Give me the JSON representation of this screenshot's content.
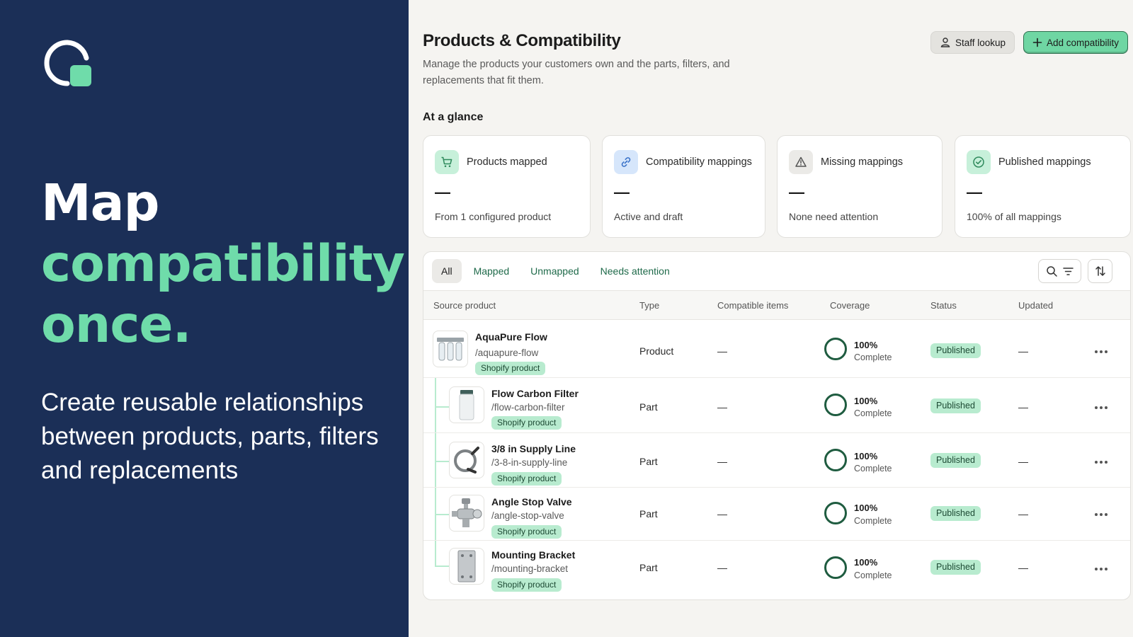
{
  "hero": {
    "headline_line1": "Map",
    "headline_line2": "compatibility",
    "headline_line3": "once.",
    "subline": "Create reusable relationships between products, parts, filters and replacements",
    "colors": {
      "background": "#1b2f57",
      "accent": "#6fdcaa"
    }
  },
  "header": {
    "title": "Products & Compatibility",
    "description": "Manage the products your customers own and the parts, filters, and replacements that fit them.",
    "staff_lookup_label": "Staff lookup",
    "add_compatibility_label": "Add compatibility"
  },
  "glance": {
    "label": "At a glance",
    "cards": [
      {
        "icon": "cart-icon",
        "title": "Products mapped",
        "value": "—",
        "sub": "From 1 configured product",
        "icon_bg": "#c7f0da",
        "icon_color": "#2f8a5c"
      },
      {
        "icon": "link-icon",
        "title": "Compatibility mappings",
        "value": "—",
        "sub": "Active and draft",
        "icon_bg": "#d6e6fb",
        "icon_color": "#3b73c9"
      },
      {
        "icon": "warning-icon",
        "title": "Missing mappings",
        "value": "—",
        "sub": "None need attention",
        "icon_bg": "#ebeae7",
        "icon_color": "#555555"
      },
      {
        "icon": "check-circle-icon",
        "title": "Published mappings",
        "value": "—",
        "sub": "100% of all mappings",
        "icon_bg": "#c7f0da",
        "icon_color": "#2f8a5c"
      }
    ]
  },
  "table": {
    "tabs": [
      "All",
      "Mapped",
      "Unmapped",
      "Needs attention"
    ],
    "active_tab": "All",
    "columns": [
      "Source product",
      "Type",
      "Compatible items",
      "Coverage",
      "Status",
      "Updated"
    ],
    "rows": [
      {
        "name": "AquaPure Flow",
        "handle": "/aquapure-flow",
        "tag": "Shopify product",
        "type": "Product",
        "compatible": "—",
        "coverage_pct": "100%",
        "coverage_label": "Complete",
        "status": "Published",
        "updated": "—",
        "thumb": "filter-system"
      },
      {
        "name": "Flow Carbon Filter",
        "handle": "/flow-carbon-filter",
        "tag": "Shopify product",
        "type": "Part",
        "compatible": "—",
        "coverage_pct": "100%",
        "coverage_label": "Complete",
        "status": "Published",
        "updated": "—",
        "thumb": "cartridge"
      },
      {
        "name": "3/8 in Supply Line",
        "handle": "/3-8-in-supply-line",
        "tag": "Shopify product",
        "type": "Part",
        "compatible": "—",
        "coverage_pct": "100%",
        "coverage_label": "Complete",
        "status": "Published",
        "updated": "—",
        "thumb": "hose"
      },
      {
        "name": "Angle Stop Valve",
        "handle": "/angle-stop-valve",
        "tag": "Shopify product",
        "type": "Part",
        "compatible": "—",
        "coverage_pct": "100%",
        "coverage_label": "Complete",
        "status": "Published",
        "updated": "—",
        "thumb": "valve"
      },
      {
        "name": "Mounting Bracket",
        "handle": "/mounting-bracket",
        "tag": "Shopify product",
        "type": "Part",
        "compatible": "—",
        "coverage_pct": "100%",
        "coverage_label": "Complete",
        "status": "Published",
        "updated": "—",
        "thumb": "bracket"
      }
    ]
  }
}
